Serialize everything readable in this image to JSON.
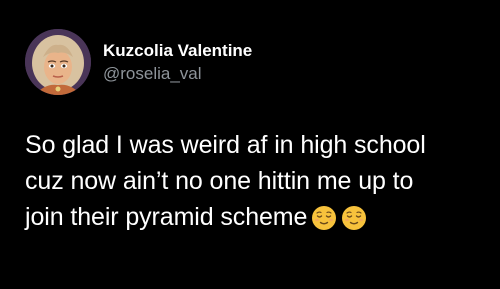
{
  "author": {
    "display_name": "Kuzcolia Valentine",
    "handle": "@roselia_val",
    "avatar_icon": "cartoon-portrait-avatar"
  },
  "tweet": {
    "line1": "So glad I was weird af in high school",
    "line2": "cuz now ain’t no one hittin me up to",
    "line3": "join their pyramid scheme",
    "emojis": [
      "relieved-face-emoji",
      "relieved-face-emoji"
    ]
  },
  "colors": {
    "background": "#000000",
    "text": "#ffffff",
    "handle": "#8e949a",
    "emoji_yellow": "#f7c23c"
  }
}
